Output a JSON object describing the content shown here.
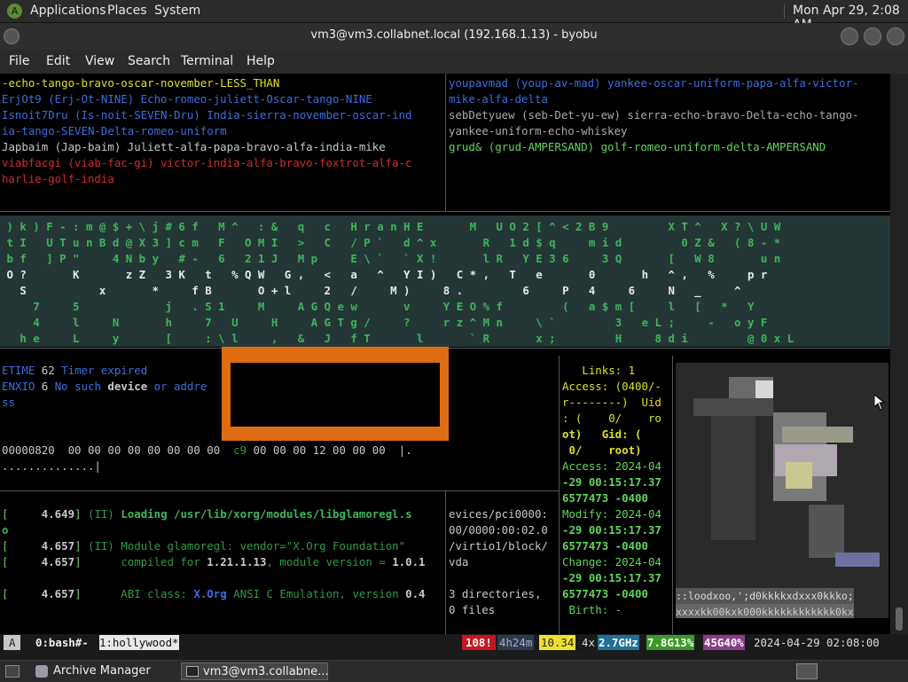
{
  "panel": {
    "applications": "Applications",
    "places": "Places",
    "system": "System",
    "clock": "Mon Apr 29,  2:08 AM"
  },
  "window": {
    "title": "vm3@vm3.collabnet.local (192.168.1.13) - byobu"
  },
  "menu": [
    "File",
    "Edit",
    "View",
    "Search",
    "Terminal",
    "Help"
  ],
  "pane_top_left": [
    "-echo-tango-bravo-oscar-november-LESS_THAN",
    "ErjOt9 (Erj-Ot-NINE) Echo-romeo-juliett-Oscar-tango-NINE",
    "Isnoit7Dru (Is-noit-SEVEN-Dru) India-sierra-november-oscar-ind",
    "ia-tango-SEVEN-Delta-romeo-uniform",
    "Japbaim (Jap-baim) Juliett-alfa-papa-bravo-alfa-india-mike",
    "viabfacgi (viab-fac-gi) victor-india-alfa-bravo-foxtrot-alfa-c",
    "harlie-golf-india"
  ],
  "pane_top_right": [
    "youpavmad (youp-av-mad) yankee-oscar-uniform-papa-alfa-victor-",
    "mike-alfa-delta",
    "sebDetyuew (seb-Det-yu-ew) sierra-echo-bravo-Delta-echo-tango-",
    "yankee-uniform-echo-whiskey",
    "grud& (grud-AMPERSAND) golf-romeo-uniform-delta-AMPERSAND"
  ],
  "matrix_rows": [
    " ) k ) F - : m @ $ + \\ j # 6 f   M ^   : &   q   c   H r a n H E       M   U O 2 [ ^ < 2 B 9         X T ^   X ? \\ U W",
    " t I   U T u n B d @ X 3 ] c m   F   O M I   >   C   / P `   d ^ x       R   1 d $ q     m i d         0 Z &   ( 8 - *  ",
    " b f   ] P \"     4 N b y   # -   6   2 1 J   M p     E \\ `   ` X !       l R   Y E 3 6     3 Q       [   W 8       u n",
    " O ?       K       z Z   3 K   t   % Q W   G ,   <   a   ^   Y I )   C * ,   T   e       0       h   ^ ,   %     p r",
    "   S           x       *     f B       O + l     2   /     M )     8 .         6     P   4     6     N   _     ^  ",
    "     7     5             j   . S 1     M     A G Q e w       v     Y E O % f         (   a $ m [     l   [   *   Y",
    "     4     l     N       h     7   U     H     A G T g /     ?     r z ^ M n     \\ `         3   e L ;     -   o y F",
    "   h e     L     y       [     : \\ l     ,   &   J   f T       l       ` R       x ;         H     8 d i         @ 0 x L"
  ],
  "pane_mid_left": {
    "line1_a": "ETIME",
    "line1_b": "62",
    "line1_c": "Timer expired",
    "line2_a": "ENXIO",
    "line2_b": "6",
    "line2_c": "No such",
    "line2_d": "device",
    "line2_e": "or addre",
    "line3": "ss"
  },
  "hexdump": {
    "line1_a": "00000820  00 00 00 00 00 00 00 00",
    "line1_b": "c9",
    "line1_c": "00 00 00 12 00 00 00  |.",
    "line2": "..............|"
  },
  "pane_bottom_left": [
    {
      "ts": "4.649",
      "tag": "(II)",
      "msg_a": "Loading",
      "msg_b": "/usr/lib/xorg/modules/libglamoregl.s",
      "cont": "o"
    },
    {
      "ts": "4.657",
      "tag": "(II)",
      "msg_a": "Module glamoregl: vendor=\"X.Org Foundation\""
    },
    {
      "ts": "4.657",
      "msg_a": "compiled for",
      "msg_b": "1.21.1.13",
      "msg_c": ", module version =",
      "msg_d": "1.0.1"
    },
    {
      "ts": "4.657",
      "msg_a": "ABI class:",
      "msg_b": "X.Org",
      "msg_c": "ANSI C Emulation, version",
      "msg_d": "0.4"
    }
  ],
  "pane_bottom_mid": [
    "evices/pci0000:",
    "00/0000:00:02.0",
    "/virtio1/block/",
    "vda",
    "",
    "3 directories,",
    "0 files"
  ],
  "pane_stat": [
    "   Links: 1",
    "Access: (0400/-",
    "r--------)  Uid",
    ": (    0/    ro",
    "ot)   Gid: (",
    " 0/    root)",
    "Access: 2024-04",
    "-29 00:15:17.37",
    "6577473 -0400",
    "Modify: 2024-04",
    "-29 00:15:17.37",
    "6577473 -0400",
    "Change: 2024-04",
    "-29 00:15:17.37",
    "6577473 -0400",
    " Birth: -"
  ],
  "ascii_art": {
    "line1": "::loodxoo,';d0kkkkxdxxx0kkko;",
    "line2": "xxxxkk00kxk000kkkkkkkkkkkk0kx"
  },
  "status": {
    "a": "A",
    "win0": "0:bash#-",
    "win1": "1:hollywood*",
    "alert": "108!",
    "uptime": "4h24m",
    "load": "10.34",
    "cpu": "4x",
    "freq": "2.7GHz",
    "mem": "7.8G13%",
    "disk": "45G40%",
    "datetime": "2024-04-29 02:08:00"
  },
  "taskbar": {
    "archive": "Archive Manager",
    "terminal": "vm3@vm3.collabne..."
  }
}
